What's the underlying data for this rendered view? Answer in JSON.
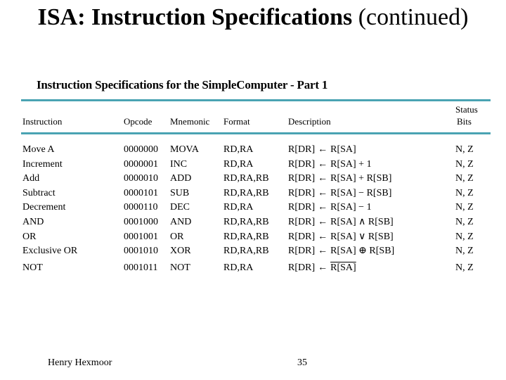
{
  "slide": {
    "title_bold": "ISA: Instruction Specifications",
    "title_normal": " (continued)"
  },
  "table": {
    "title": "Instruction Specifications for the SimpleComputer - Part 1",
    "accent_color": "#4aa3b3",
    "headers": {
      "instruction": "Instruction",
      "opcode": "Opcode",
      "mnemonic": "Mnemonic",
      "format": "Format",
      "description": "Description",
      "status_line1": "Status",
      "status_line2": "Bits"
    },
    "rows": [
      {
        "instruction": "Move A",
        "opcode": "0000000",
        "mnemonic": "MOVA",
        "format": "RD,RA",
        "desc_lhs": "R[DR]",
        "arrow": "←",
        "desc_rhs": "R[SA]",
        "status": "N, Z"
      },
      {
        "instruction": "Increment",
        "opcode": "0000001",
        "mnemonic": "INC",
        "format": "RD,RA",
        "desc_lhs": "R[DR]",
        "arrow": "←",
        "desc_rhs": "R[SA] + 1",
        "status": "N, Z"
      },
      {
        "instruction": "Add",
        "opcode": "0000010",
        "mnemonic": "ADD",
        "format": "RD,RA,RB",
        "desc_lhs": "R[DR]",
        "arrow": "←",
        "desc_rhs": "R[SA] + R[SB]",
        "status": "N, Z"
      },
      {
        "instruction": "Subtract",
        "opcode": "0000101",
        "mnemonic": "SUB",
        "format": "RD,RA,RB",
        "desc_lhs": "R[DR]",
        "arrow": "←",
        "desc_rhs": "R[SA] − R[SB]",
        "status": "N, Z"
      },
      {
        "instruction": "Decrement",
        "opcode": "0000110",
        "mnemonic": "DEC",
        "format": "RD,RA",
        "desc_lhs": "R[DR]",
        "arrow": "←",
        "desc_rhs": "R[SA] − 1",
        "status": "N, Z"
      },
      {
        "instruction": "AND",
        "opcode": "0001000",
        "mnemonic": "AND",
        "format": "RD,RA,RB",
        "desc_lhs": "R[DR]",
        "arrow": "←",
        "desc_rhs": "R[SA] ∧ R[SB]",
        "status": "N, Z"
      },
      {
        "instruction": "OR",
        "opcode": "0001001",
        "mnemonic": "OR",
        "format": "RD,RA,RB",
        "desc_lhs": "R[DR]",
        "arrow": "←",
        "desc_rhs": "R[SA] ∨ R[SB]",
        "status": "N, Z"
      },
      {
        "instruction": "Exclusive OR",
        "opcode": "0001010",
        "mnemonic": "XOR",
        "format": "RD,RA,RB",
        "desc_lhs": "R[DR]",
        "arrow": "←",
        "desc_rhs": "R[SA] ⊕ R[SB]",
        "status": "N, Z"
      },
      {
        "instruction": "NOT",
        "opcode": "0001011",
        "mnemonic": "NOT",
        "format": "RD,RA",
        "desc_lhs": "R[DR]",
        "arrow": "←",
        "desc_rhs": "R[SA]",
        "desc_rhs_overline": true,
        "status": "N, Z"
      }
    ]
  },
  "footer": {
    "author": "Henry Hexmoor",
    "page_number": "35"
  }
}
